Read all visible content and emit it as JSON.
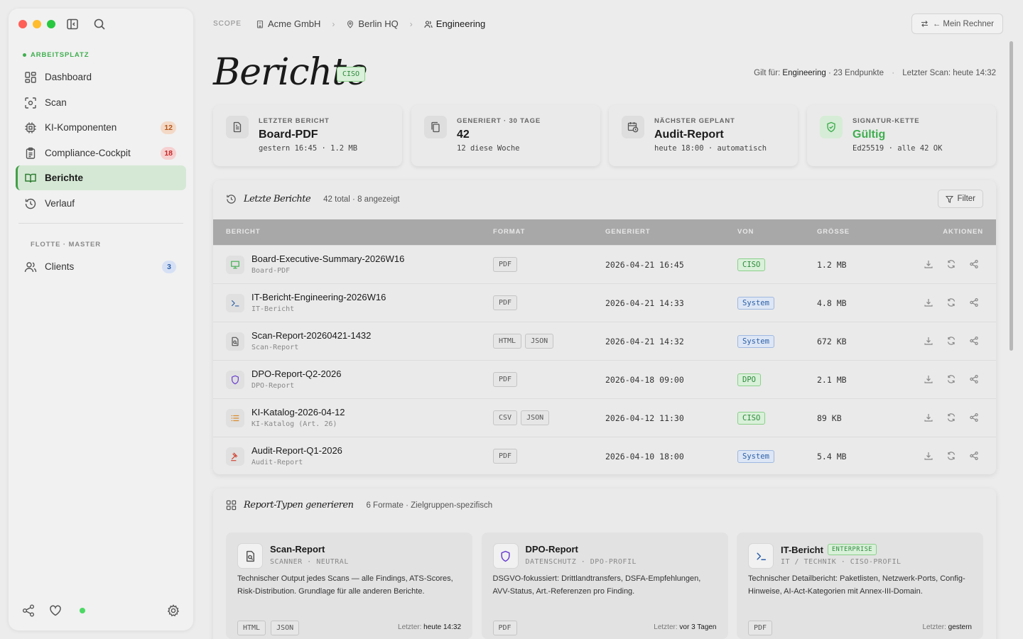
{
  "sidebar": {
    "section_workspace": "ARBEITSPLATZ",
    "section_fleet": "FLOTTE · MASTER",
    "items": [
      {
        "label": "Dashboard",
        "icon": "dashboard-icon"
      },
      {
        "label": "Scan",
        "icon": "scan-icon"
      },
      {
        "label": "KI-Komponenten",
        "icon": "chip-icon",
        "badge": "12"
      },
      {
        "label": "Compliance-Cockpit",
        "icon": "clipboard-icon",
        "badge": "18"
      },
      {
        "label": "Berichte",
        "icon": "book-icon",
        "active": true
      },
      {
        "label": "Verlauf",
        "icon": "history-icon"
      }
    ],
    "fleet_items": [
      {
        "label": "Clients",
        "icon": "users-icon",
        "badge": "3"
      }
    ]
  },
  "breadcrumb": {
    "scope": "SCOPE",
    "items": [
      "Acme GmbH",
      "Berlin HQ",
      "Engineering"
    ]
  },
  "header": {
    "mein_rechner": "← Mein Rechner",
    "title": "Berichte",
    "role_tag": "CISO",
    "meta_prefix": "Gilt für:",
    "meta_scope": "Engineering",
    "meta_endpoints": "· 23 Endpunkte",
    "meta_dot": "·",
    "meta_scan": "Letzter Scan: heute 14:32"
  },
  "stats": [
    {
      "label": "LETZTER BERICHT",
      "value": "Board-PDF",
      "sub": "gestern 16:45 · 1.2 MB",
      "icon": "document-icon"
    },
    {
      "label": "GENERIERT · 30 TAGE",
      "value": "42",
      "sub": "12 diese Woche",
      "icon": "copy-icon"
    },
    {
      "label": "NÄCHSTER GEPLANT",
      "value": "Audit-Report",
      "sub": "heute 18:00 · automatisch",
      "icon": "calendar-clock-icon"
    },
    {
      "label": "SIGNATUR-KETTE",
      "value": "Gültig",
      "sub": "Ed25519 · alle 42 OK",
      "icon": "shield-check-icon",
      "accent": "#3fae4f"
    }
  ],
  "reports_panel": {
    "title": "Letzte Berichte",
    "count": "42 total · 8 angezeigt",
    "filter_label": "Filter",
    "columns": [
      "BERICHT",
      "FORMAT",
      "GENERIERT",
      "VON",
      "GRÖSSE",
      "AKTIONEN"
    ],
    "rows": [
      {
        "name": "Board-Executive-Summary-2026W16",
        "type": "Board-PDF",
        "formats": [
          "PDF"
        ],
        "generated": "2026-04-21 16:45",
        "by": "CISO",
        "by_color": "green",
        "size": "1.2 MB",
        "icon": "presentation-icon",
        "icon_color": "#3fae4f"
      },
      {
        "name": "IT-Bericht-Engineering-2026W16",
        "type": "IT-Bericht",
        "formats": [
          "PDF"
        ],
        "generated": "2026-04-21 14:33",
        "by": "System",
        "by_color": "blue",
        "size": "4.8 MB",
        "icon": "terminal-icon",
        "icon_color": "#2b5fa8"
      },
      {
        "name": "Scan-Report-20260421-1432",
        "type": "Scan-Report",
        "formats": [
          "HTML",
          "JSON"
        ],
        "generated": "2026-04-21 14:32",
        "by": "System",
        "by_color": "blue",
        "size": "672 KB",
        "icon": "file-scan-icon",
        "icon_color": "#555555"
      },
      {
        "name": "DPO-Report-Q2-2026",
        "type": "DPO-Report",
        "formats": [
          "PDF"
        ],
        "generated": "2026-04-18 09:00",
        "by": "DPO",
        "by_color": "green",
        "size": "2.1 MB",
        "icon": "shield-icon",
        "icon_color": "#6a3fd0"
      },
      {
        "name": "KI-Katalog-2026-04-12",
        "type": "KI-Katalog (Art. 26)",
        "formats": [
          "CSV",
          "JSON"
        ],
        "generated": "2026-04-12 11:30",
        "by": "CISO",
        "by_color": "green",
        "size": "89 KB",
        "icon": "list-icon",
        "icon_color": "#d98a2b"
      },
      {
        "name": "Audit-Report-Q1-2026",
        "type": "Audit-Report",
        "formats": [
          "PDF"
        ],
        "generated": "2026-04-10 18:00",
        "by": "System",
        "by_color": "blue",
        "size": "5.4 MB",
        "icon": "gavel-icon",
        "icon_color": "#d0402f"
      }
    ]
  },
  "types_panel": {
    "title": "Report-Typen generieren",
    "count": "6 Formate · Zielgruppen-spezifisch",
    "last_prefix": "Letzter:",
    "cards": [
      {
        "name": "Scan-Report",
        "sub": "SCANNER · NEUTRAL",
        "desc": "Technischer Output jedes Scans — alle Findings, ATS-Scores, Risk-Distribution. Grundlage für alle anderen Berichte.",
        "formats": [
          "HTML",
          "JSON"
        ],
        "last": "heute 14:32",
        "icon": "file-scan-icon",
        "icon_color": "#555555"
      },
      {
        "name": "DPO-Report",
        "sub": "DATENSCHUTZ · DPO-PROFIL",
        "desc": "DSGVO-fokussiert: Drittlandtransfers, DSFA-Empfehlungen, AVV-Status, Art.-Referenzen pro Finding.",
        "formats": [
          "PDF"
        ],
        "last": "vor 3 Tagen",
        "icon": "shield-icon",
        "icon_color": "#6a3fd0"
      },
      {
        "name": "IT-Bericht",
        "badge": "ENTERPRISE",
        "sub": "IT / TECHNIK · CISO-PROFIL",
        "desc": "Technischer Detailbericht: Paketlisten, Netzwerk-Ports, Config-Hinweise, AI-Act-Kategorien mit Annex-III-Domain.",
        "formats": [
          "PDF"
        ],
        "last": "gestern",
        "icon": "terminal-icon",
        "icon_color": "#2b5fa8"
      }
    ]
  },
  "colors": {
    "accent": "#43a047",
    "active_bg": "#d5e8d5",
    "badge_orange": "#f3d9c6",
    "badge_red": "#f6d0d0",
    "badge_blue": "#d6e0f5"
  }
}
